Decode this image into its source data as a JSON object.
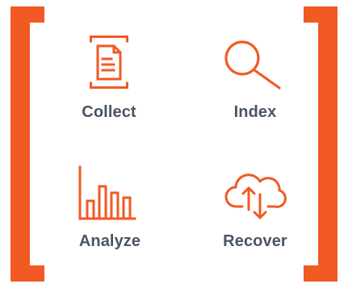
{
  "colors": {
    "accent": "#f15a22",
    "text": "#4a5563",
    "background": "#ffffff"
  },
  "items": [
    {
      "label": "Collect",
      "icon": "document-capture-icon"
    },
    {
      "label": "Index",
      "icon": "magnifying-glass-icon"
    },
    {
      "label": "Analyze",
      "icon": "bar-chart-icon"
    },
    {
      "label": "Recover",
      "icon": "cloud-sync-icon"
    }
  ]
}
